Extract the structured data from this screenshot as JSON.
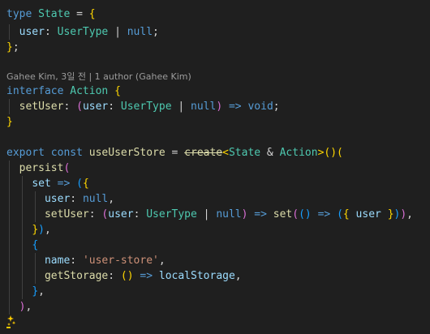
{
  "editor": {
    "blame": "Gahee Kim, 3일 전 | 1 author (Gahee Kim)",
    "tokens": {
      "type": "type",
      "State": "State",
      "eq": " = ",
      "lbrace": "{",
      "rbrace": "}",
      "semi": ";",
      "user": "user",
      "colon": ": ",
      "UserType": "UserType",
      "pipe": " | ",
      "null": "null",
      "interface": "interface",
      "Action": "Action",
      "setUser": "setUser",
      "lparen": "(",
      "rparen": ")",
      "arrow": " => ",
      "void": "void",
      "export": "export",
      "const": "const",
      "useUserStore": "useUserStore",
      "create": "create",
      "lt": "<",
      "amp": " & ",
      "gt": ">",
      "callopen": "()(",
      "persist": "persist",
      "set": "set",
      "comma": ",",
      "name": "name",
      "userStore": "'user-store'",
      "getStorage": "getStorage",
      "emptyParens": "()",
      "localStorage": "localStorage"
    }
  }
}
